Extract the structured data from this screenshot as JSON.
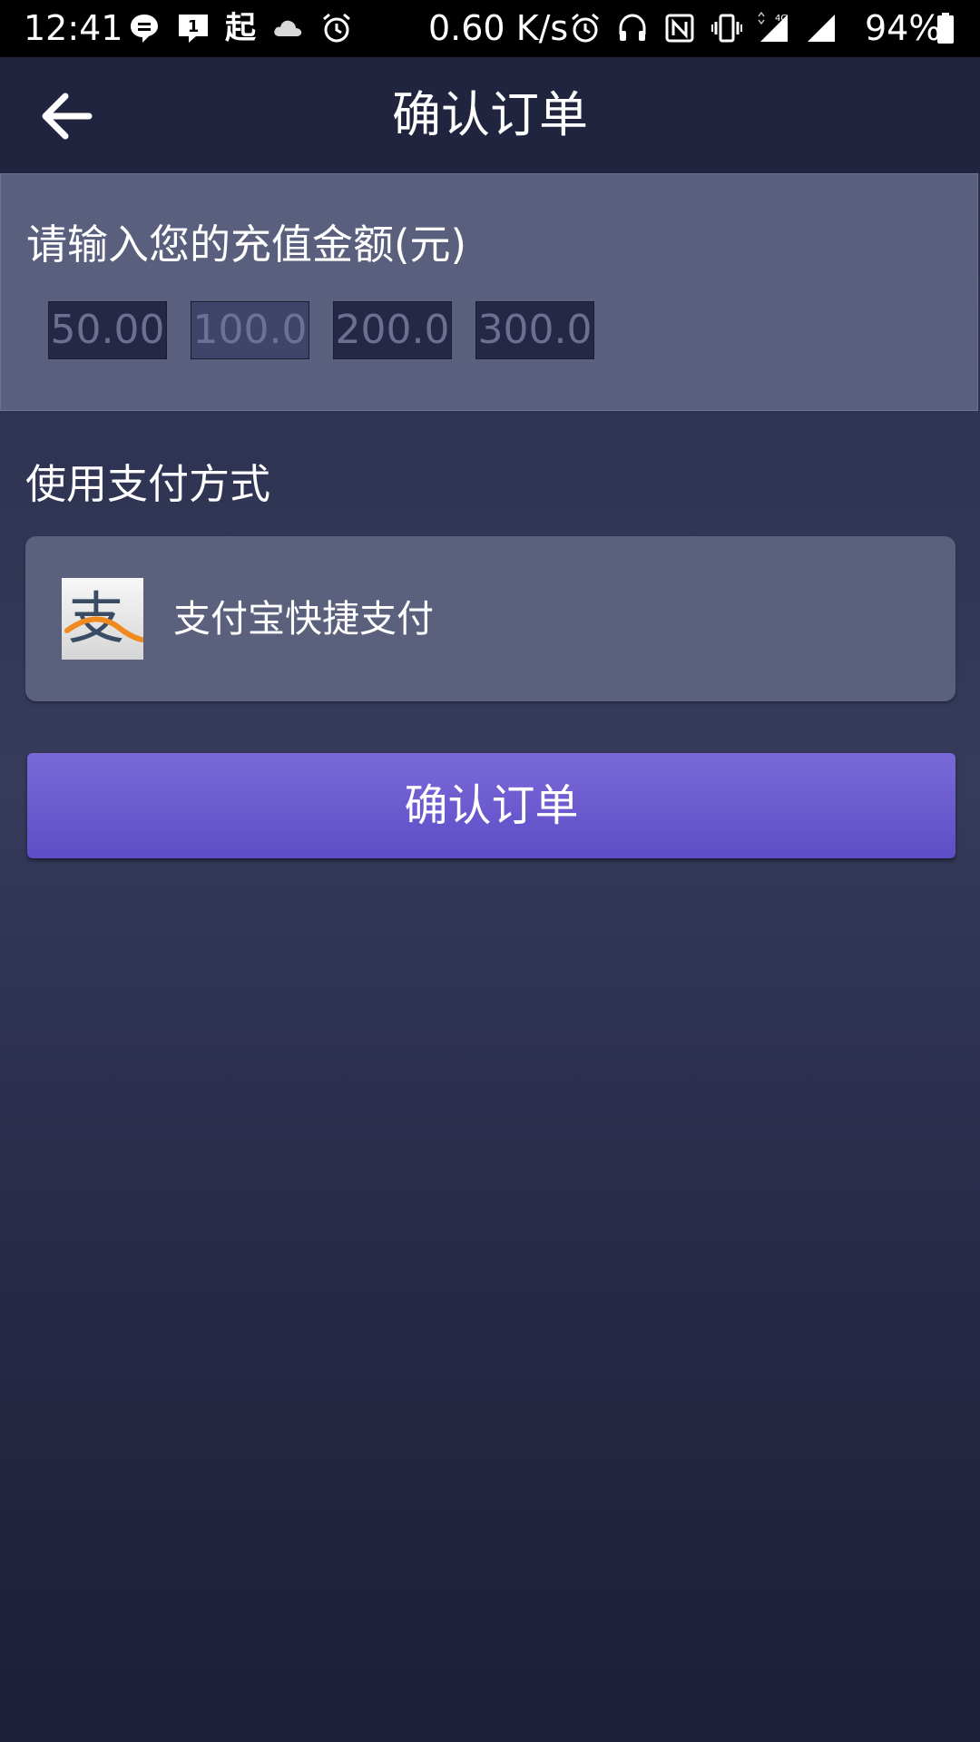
{
  "status_bar": {
    "time": "12:41",
    "net_speed": "0.60 K/s",
    "network_type": "4G",
    "battery": "94%",
    "left_icons": [
      "message-icon",
      "notification-1-icon",
      "qi-app-icon",
      "cloud-icon",
      "alarm-icon"
    ],
    "right_icons": [
      "alarm-icon",
      "headphones-icon",
      "nfc-icon",
      "vibrate-icon",
      "signal-icon",
      "wifi-signal-icon",
      "battery-icon"
    ],
    "qi_glyph": "起",
    "notif_count": "1"
  },
  "app_bar": {
    "title": "确认订单",
    "back_icon": "arrow-left-icon"
  },
  "recharge": {
    "label": "请输入您的充值金额(元)",
    "options": [
      "50.00",
      "100.0",
      "200.0",
      "300.0"
    ],
    "selected_index": 1
  },
  "payment": {
    "label": "使用支付方式",
    "method_name": "支付宝快捷支付",
    "method_icon": "alipay-icon",
    "icon_glyph": "支"
  },
  "confirm_button": {
    "label": "确认订单"
  },
  "colors": {
    "status_bar": "#000000",
    "app_bar": "#21243f",
    "panel": "#5a5f7e",
    "chip": "#252844",
    "button_top": "#7a6ad8",
    "button_bottom": "#5e4dc6",
    "alipay_orange": "#f08a1e"
  }
}
